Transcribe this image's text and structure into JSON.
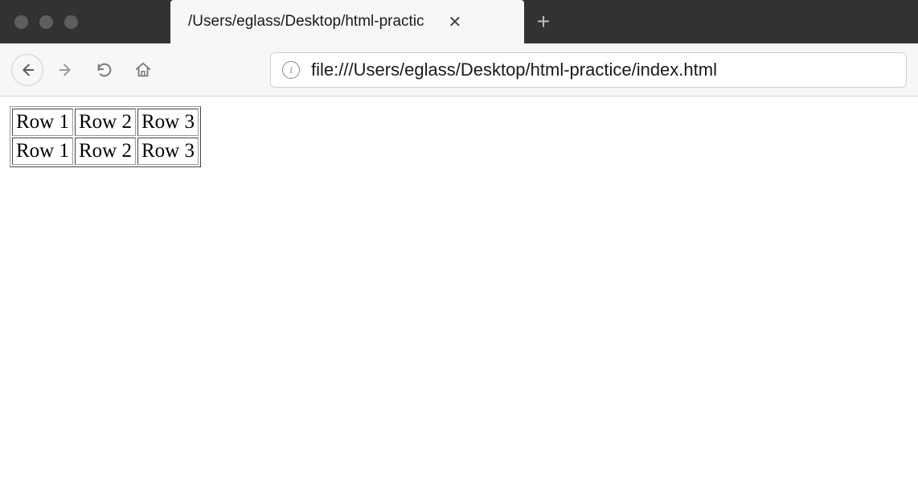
{
  "tab": {
    "title": "/Users/eglass/Desktop/html-practic"
  },
  "addressbar": {
    "url": "file:///Users/eglass/Desktop/html-practice/index.html"
  },
  "table": {
    "rows": [
      [
        "Row 1",
        "Row 2",
        "Row 3"
      ],
      [
        "Row 1",
        "Row 2",
        "Row 3"
      ]
    ]
  }
}
